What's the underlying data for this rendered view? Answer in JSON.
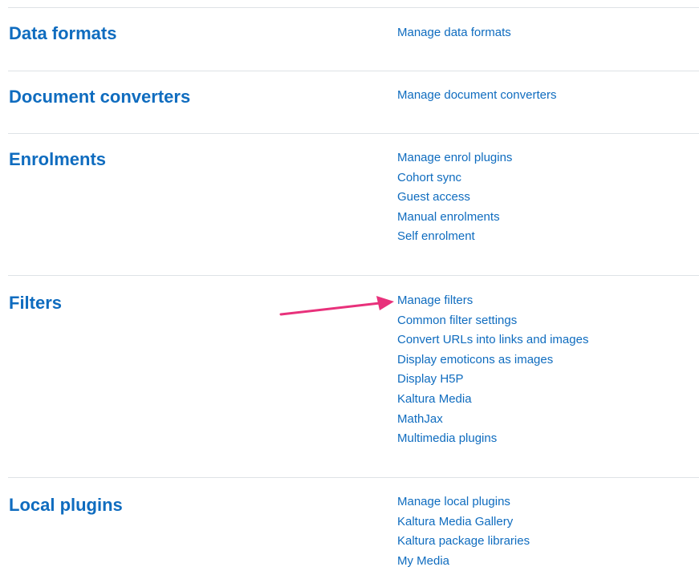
{
  "sections": [
    {
      "title": "Data formats",
      "links": [
        "Manage data formats"
      ]
    },
    {
      "title": "Document converters",
      "links": [
        "Manage document converters"
      ]
    },
    {
      "title": "Enrolments",
      "links": [
        "Manage enrol plugins",
        "Cohort sync",
        "Guest access",
        "Manual enrolments",
        "Self enrolment"
      ]
    },
    {
      "title": "Filters",
      "links": [
        "Manage filters",
        "Common filter settings",
        "Convert URLs into links and images",
        "Display emoticons as images",
        "Display H5P",
        "Kaltura Media",
        "MathJax",
        "Multimedia plugins"
      ]
    },
    {
      "title": "Local plugins",
      "links": [
        "Manage local plugins",
        "Kaltura Media Gallery",
        "Kaltura package libraries",
        "My Media"
      ]
    }
  ],
  "colors": {
    "link": "#0f6cbf",
    "heading": "#0f6cbf",
    "divider": "#dee2e6",
    "annotation_arrow": "#e8317b"
  }
}
